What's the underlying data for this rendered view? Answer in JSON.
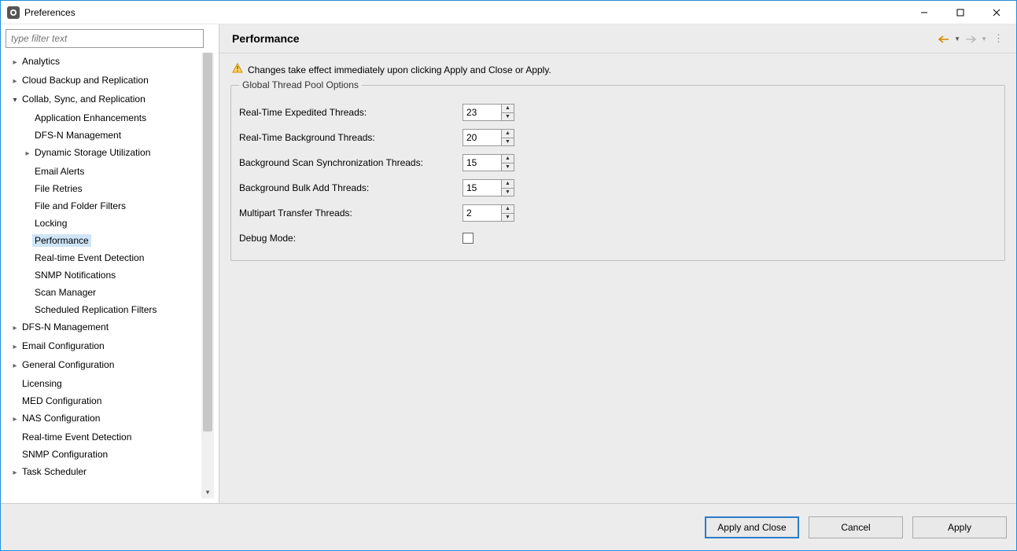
{
  "window": {
    "title": "Preferences"
  },
  "filter": {
    "placeholder": "type filter text"
  },
  "tree": {
    "items": [
      {
        "label": "Analytics",
        "expand": "closed",
        "depth": 0
      },
      {
        "label": "Cloud Backup and Replication",
        "expand": "closed",
        "depth": 0
      },
      {
        "label": "Collab, Sync, and Replication",
        "expand": "open",
        "depth": 0
      },
      {
        "label": "Application Enhancements",
        "expand": "none",
        "depth": 1
      },
      {
        "label": "DFS-N Management",
        "expand": "none",
        "depth": 1
      },
      {
        "label": "Dynamic Storage Utilization",
        "expand": "closed",
        "depth": 1
      },
      {
        "label": "Email Alerts",
        "expand": "none",
        "depth": 1
      },
      {
        "label": "File Retries",
        "expand": "none",
        "depth": 1
      },
      {
        "label": "File and Folder Filters",
        "expand": "none",
        "depth": 1
      },
      {
        "label": "Locking",
        "expand": "none",
        "depth": 1
      },
      {
        "label": "Performance",
        "expand": "none",
        "depth": 1,
        "selected": true
      },
      {
        "label": "Real-time Event Detection",
        "expand": "none",
        "depth": 1
      },
      {
        "label": "SNMP Notifications",
        "expand": "none",
        "depth": 1
      },
      {
        "label": "Scan Manager",
        "expand": "none",
        "depth": 1
      },
      {
        "label": "Scheduled Replication Filters",
        "expand": "none",
        "depth": 1
      },
      {
        "label": "DFS-N Management",
        "expand": "closed",
        "depth": 0
      },
      {
        "label": "Email Configuration",
        "expand": "closed",
        "depth": 0
      },
      {
        "label": "General Configuration",
        "expand": "closed",
        "depth": 0
      },
      {
        "label": "Licensing",
        "expand": "none",
        "depth": 0
      },
      {
        "label": "MED Configuration",
        "expand": "none",
        "depth": 0
      },
      {
        "label": "NAS Configuration",
        "expand": "closed",
        "depth": 0
      },
      {
        "label": "Real-time Event Detection",
        "expand": "none",
        "depth": 0
      },
      {
        "label": "SNMP Configuration",
        "expand": "none",
        "depth": 0
      },
      {
        "label": "Task Scheduler",
        "expand": "closed",
        "depth": 0
      }
    ]
  },
  "page": {
    "title": "Performance",
    "warning": "Changes take effect immediately upon clicking Apply and Close or Apply.",
    "group_title": "Global Thread Pool Options",
    "fields": {
      "rt_exp": {
        "label": "Real-Time Expedited Threads:",
        "value": "23"
      },
      "rt_bg": {
        "label": "Real-Time Background Threads:",
        "value": "20"
      },
      "bg_sync": {
        "label": "Background Scan Synchronization Threads:",
        "value": "15"
      },
      "bg_bulk": {
        "label": "Background Bulk Add Threads:",
        "value": "15"
      },
      "multipart": {
        "label": "Multipart Transfer Threads:",
        "value": "2"
      },
      "debug": {
        "label": "Debug Mode:"
      }
    }
  },
  "buttons": {
    "apply_close": "Apply and Close",
    "cancel": "Cancel",
    "apply": "Apply"
  }
}
